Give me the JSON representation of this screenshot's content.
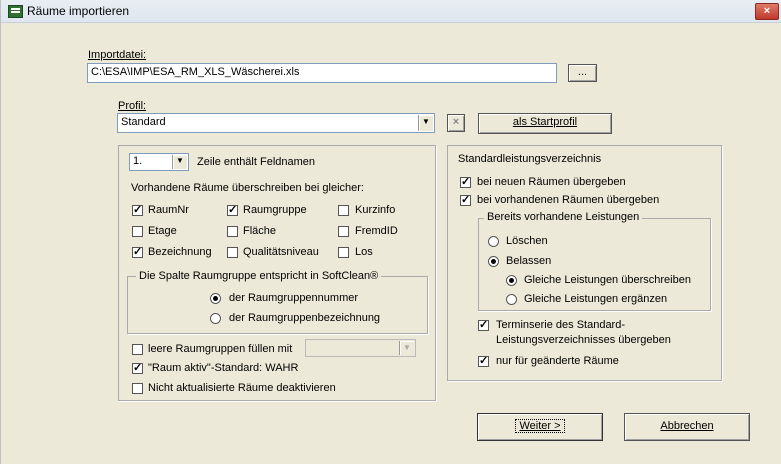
{
  "window": {
    "title": "Räume importieren",
    "close_label": "×"
  },
  "import": {
    "label": "Importdatei:",
    "path": "C:\\ESA\\IMP\\ESA_RM_XLS_Wäscherei.xls",
    "browse_label": "..."
  },
  "profile": {
    "label": "Profil:",
    "value": "Standard",
    "delete_label": "×",
    "startprofile_label": "als Startprofil"
  },
  "left_panel": {
    "row_value": "1.",
    "row_label": "Zeile enthält Feldnamen",
    "overwrite_label": "Vorhandene Räume überschreiben bei gleicher:",
    "fields": [
      {
        "label": "RaumNr",
        "checked": true
      },
      {
        "label": "Raumgruppe",
        "checked": true
      },
      {
        "label": "Kurzinfo",
        "checked": false
      },
      {
        "label": "Etage",
        "checked": false
      },
      {
        "label": "Fläche",
        "checked": false
      },
      {
        "label": "FremdID",
        "checked": false
      },
      {
        "label": "Bezeichnung",
        "checked": true
      },
      {
        "label": "Qualitätsniveau",
        "checked": false
      },
      {
        "label": "Los",
        "checked": false
      }
    ],
    "raumgruppe_group": {
      "title": "Die Spalte Raumgruppe entspricht in SoftClean®",
      "options": [
        {
          "label": "der Raumgruppennummer",
          "selected": true
        },
        {
          "label": "der Raumgruppenbezeichnung",
          "selected": false
        }
      ]
    },
    "options": [
      {
        "label": "leere Raumgruppen füllen mit",
        "checked": false
      },
      {
        "label": "\"Raum aktiv\"-Standard: WAHR",
        "checked": true
      },
      {
        "label": "Nicht aktualisierte Räume deaktivieren",
        "checked": false
      }
    ]
  },
  "right_panel": {
    "title": "Standardleistungsverzeichnis",
    "new_rooms": {
      "label": "bei neuen Räumen übergeben",
      "checked": true
    },
    "existing_rooms": {
      "label": "bei vorhandenen Räumen übergeben",
      "checked": true
    },
    "existing_group": {
      "title": "Bereits vorhandene Leistungen",
      "delete": {
        "label": "Löschen",
        "selected": false
      },
      "keep": {
        "label": "Belassen",
        "selected": true
      },
      "overwrite": {
        "label": "Gleiche Leistungen überschreiben",
        "selected": true
      },
      "supplement": {
        "label": "Gleiche Leistungen ergänzen",
        "selected": false
      }
    },
    "termin": {
      "label_line1": "Terminserie des Standard-",
      "label_line2": "Leistungsverzeichnisses übergeben",
      "checked": true
    },
    "changed_only": {
      "label": "nur für geänderte Räume",
      "checked": true
    }
  },
  "buttons": {
    "next": "Weiter >",
    "cancel": "Abbrechen"
  }
}
